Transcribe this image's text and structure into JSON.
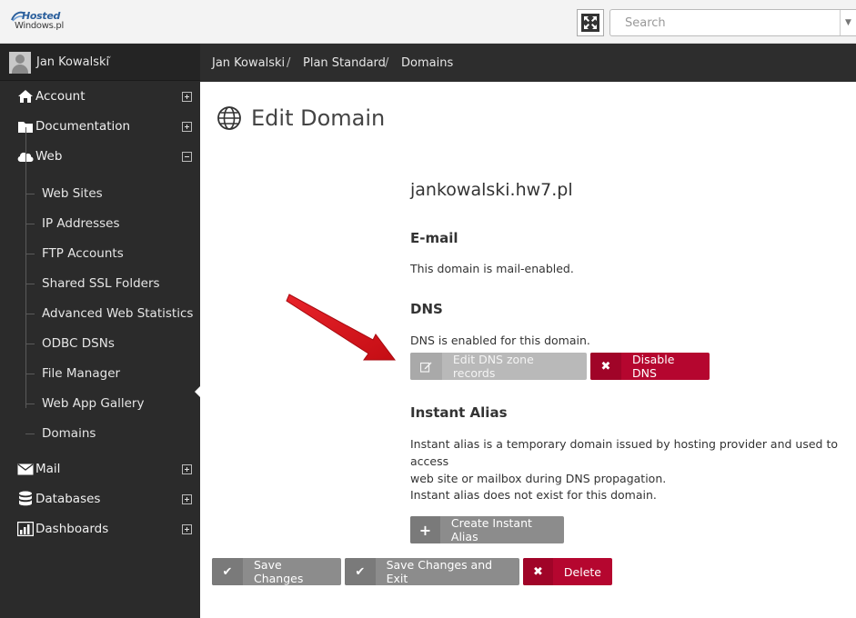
{
  "header": {
    "logo_line1": "Hosted",
    "logo_line2": "Windows.pl",
    "search_placeholder": "Search"
  },
  "user": {
    "name": "Jan Kowalski"
  },
  "sidebar": {
    "items": [
      {
        "label": "Account",
        "icon": "home-icon"
      },
      {
        "label": "Documentation",
        "icon": "folder-icon"
      },
      {
        "label": "Web",
        "icon": "cloud-icon"
      },
      {
        "label": "Mail",
        "icon": "envelope-icon"
      },
      {
        "label": "Databases",
        "icon": "database-icon"
      },
      {
        "label": "Dashboards",
        "icon": "bar-chart-icon"
      }
    ],
    "web_subitems": [
      "Web Sites",
      "IP Addresses",
      "FTP Accounts",
      "Shared SSL Folders",
      "Advanced Web Statistics",
      "ODBC DSNs",
      "File Manager",
      "Web App Gallery",
      "Domains"
    ]
  },
  "breadcrumb": [
    "Jan Kowalski",
    "Plan Standard",
    "Domains"
  ],
  "breadcrumb_sep": "/",
  "page": {
    "title": "Edit Domain",
    "domain": "jankowalski.hw7.pl",
    "email_heading": "E-mail",
    "email_text": "This domain is mail-enabled.",
    "dns_heading": "DNS",
    "dns_text": "DNS is enabled for this domain.",
    "edit_dns_label": "Edit DNS zone records",
    "disable_dns_label": "Disable DNS",
    "alias_heading": "Instant Alias",
    "alias_text_line1": "Instant alias is a temporary domain issued by hosting provider and used to access",
    "alias_text_line2": "web site or mailbox during DNS propagation.",
    "alias_status": "Instant alias does not exist for this domain.",
    "create_alias_label": "Create Instant Alias"
  },
  "footer_buttons": {
    "save_label": "Save Changes",
    "save_exit_label": "Save Changes and Exit",
    "delete_label": "Delete"
  },
  "colors": {
    "sidebar_bg": "#2b2b2b",
    "danger": "#b5062f",
    "neutral_button": "#8c8c8c",
    "annotation_arrow": "#d8141b"
  }
}
